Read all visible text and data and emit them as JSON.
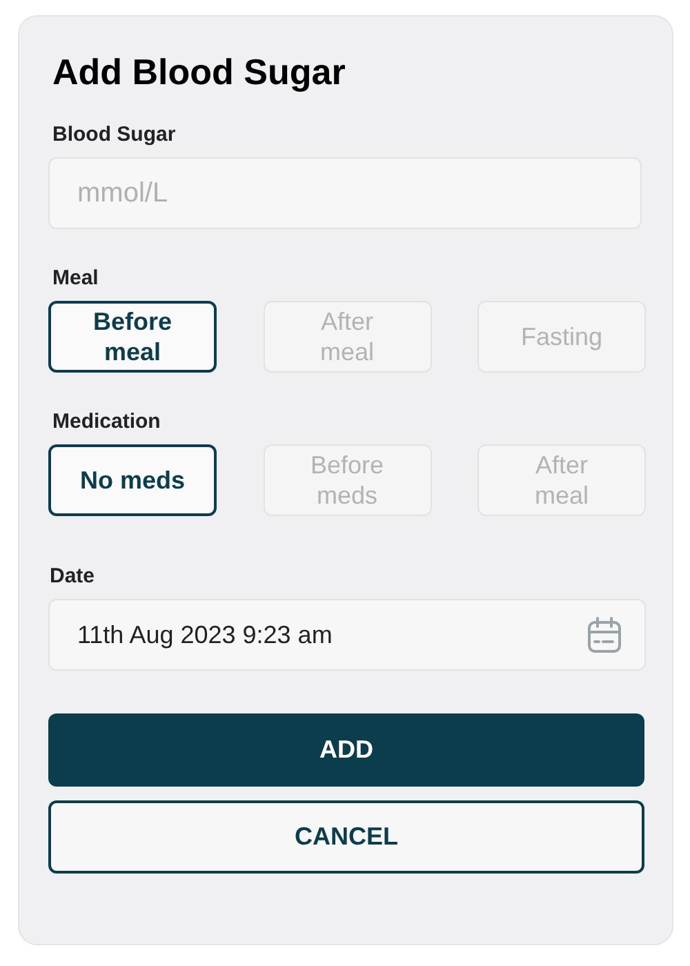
{
  "title": "Add Blood Sugar",
  "blood_sugar": {
    "label": "Blood Sugar",
    "placeholder": "mmol/L"
  },
  "meal": {
    "label": "Meal",
    "options": [
      {
        "label": "Before meal",
        "selected": true
      },
      {
        "label": "After meal",
        "selected": false
      },
      {
        "label": "Fasting",
        "selected": false
      }
    ]
  },
  "medication": {
    "label": "Medication",
    "options": [
      {
        "label": "No meds",
        "selected": true
      },
      {
        "label": "Before meds",
        "selected": false
      },
      {
        "label": "After meal",
        "selected": false
      }
    ]
  },
  "date": {
    "label": "Date",
    "value": "11th Aug 2023 9:23 am"
  },
  "buttons": [
    {
      "label": "ADD",
      "kind": "primary"
    },
    {
      "label": "CANCEL",
      "kind": "secondary"
    }
  ]
}
